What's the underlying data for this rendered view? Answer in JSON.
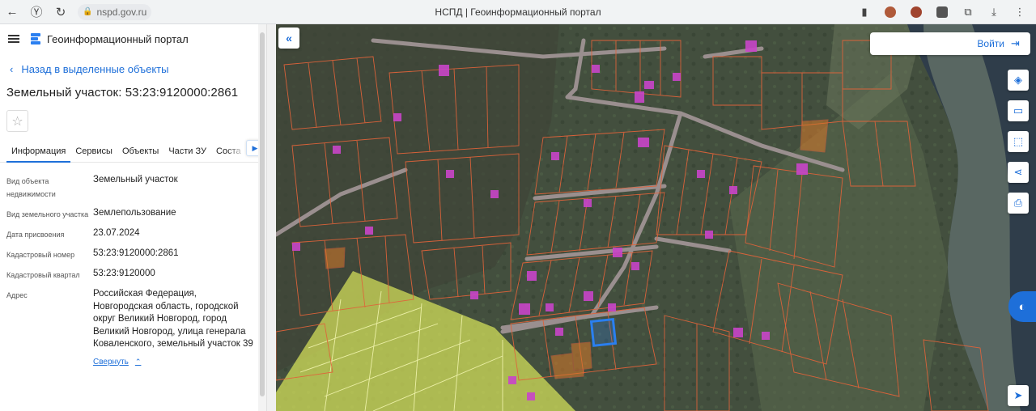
{
  "browser": {
    "url": "nspd.gov.ru",
    "window_title": "НСПД | Геоинформационный портал",
    "icons": [
      "back-arrow-icon",
      "yandex-icon",
      "reload-icon",
      "lock-icon",
      "bookmark-icon",
      "extension-icon",
      "download-icon",
      "menu-icon"
    ]
  },
  "app": {
    "title": "Геоинформационный портал",
    "back_link": "Назад в выделенные объекты",
    "object_title": "Земельный участок: 53:23:9120000:2861"
  },
  "tabs": [
    {
      "label": "Информация",
      "active": true
    },
    {
      "label": "Сервисы"
    },
    {
      "label": "Объекты"
    },
    {
      "label": "Части ЗУ"
    },
    {
      "label": "Соста"
    }
  ],
  "properties": [
    {
      "label": "Вид объекта недвижимости",
      "value": "Земельный участок"
    },
    {
      "label": "Вид земельного участка",
      "value": "Землепользование"
    },
    {
      "label": "Дата присвоения",
      "value": "23.07.2024"
    },
    {
      "label": "Кадастровый номер",
      "value": "53:23:9120000:2861"
    },
    {
      "label": "Кадастровый квартал",
      "value": "53:23:9120000"
    },
    {
      "label": "Адрес",
      "value": "Российская Федерация, Новгородская область, городской округ Великий Новгород, город Великий Новгород, улица генерала Коваленского, земельный участок 39"
    }
  ],
  "collapse_label": "Свернуть",
  "map": {
    "login_label": "Войти",
    "colors": {
      "parcel_outline": "#e0633a",
      "building": "#c945c9",
      "selected": "#2a7ff0",
      "zone": "#d7e35a",
      "river": "#2f3d4a"
    }
  }
}
